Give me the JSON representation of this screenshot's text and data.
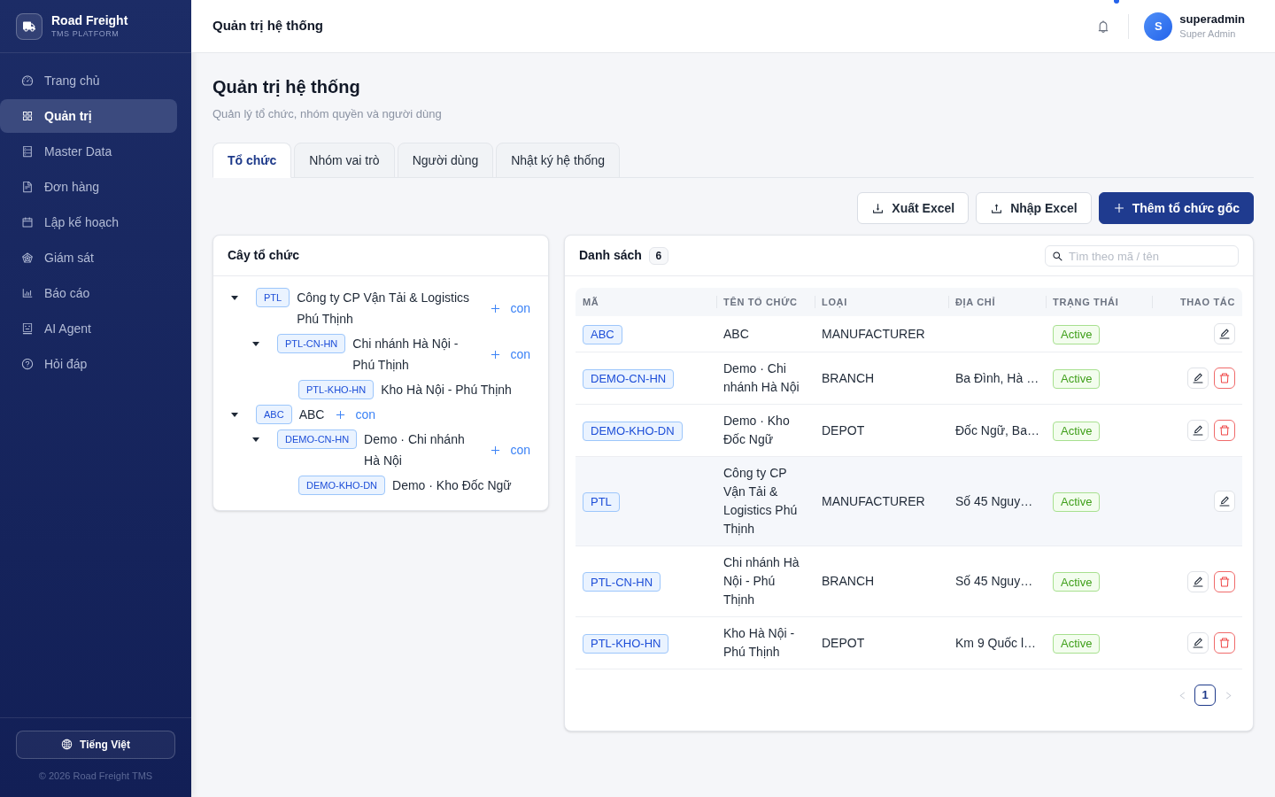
{
  "sidebar": {
    "brand": {
      "name": "Road Freight",
      "tagline": "TMS PLATFORM"
    },
    "items": [
      {
        "label": "Trang chủ",
        "selected": false
      },
      {
        "label": "Quản trị",
        "selected": true
      },
      {
        "label": "Master Data",
        "selected": false
      },
      {
        "label": "Đơn hàng",
        "selected": false
      },
      {
        "label": "Lập kế hoạch",
        "selected": false
      },
      {
        "label": "Giám sát",
        "selected": false
      },
      {
        "label": "Báo cáo",
        "selected": false
      },
      {
        "label": "AI Agent",
        "selected": false
      },
      {
        "label": "Hỏi đáp",
        "selected": false
      }
    ],
    "language_button": "Tiếng Việt",
    "footer": "© 2026 Road Freight TMS"
  },
  "header": {
    "title": "Quản trị hệ thống",
    "has_notification": true,
    "user": {
      "initial": "S",
      "name": "superadmin",
      "role": "Super Admin"
    }
  },
  "page": {
    "title": "Quản trị hệ thống",
    "subtitle": "Quản lý tổ chức, nhóm quyền và người dùng"
  },
  "tabs": [
    {
      "label": "Tổ chức",
      "selected": true
    },
    {
      "label": "Nhóm vai trò",
      "selected": false
    },
    {
      "label": "Người dùng",
      "selected": false
    },
    {
      "label": "Nhật ký hệ thống",
      "selected": false
    }
  ],
  "actions": [
    {
      "label": "Xuất Excel",
      "kind": "export"
    },
    {
      "label": "Nhập Excel",
      "kind": "import"
    },
    {
      "label": "Thêm tổ chức gốc",
      "kind": "primary"
    }
  ],
  "tree_panel": {
    "title": "Cây tổ chức",
    "nodes": [
      {
        "code": "PTL",
        "name": "Công ty CP Vận Tải & Logistics Phú Thịnh",
        "expanded": true,
        "add_label": "con",
        "children": [
          {
            "code": "PTL-CN-HN",
            "name": "Chi nhánh Hà Nội - Phú Thịnh",
            "expanded": true,
            "add_label": "con",
            "children": [
              {
                "code": "PTL-KHO-HN",
                "name": "Kho Hà Nội - Phú Thịnh"
              }
            ]
          }
        ]
      },
      {
        "code": "ABC",
        "name": "ABC",
        "expanded": true,
        "add_label": "con",
        "children": [
          {
            "code": "DEMO-CN-HN",
            "name": "Demo · Chi nhánh Hà Nội",
            "expanded": true,
            "add_label": "con",
            "children": [
              {
                "code": "DEMO-KHO-DN",
                "name": "Demo · Kho Đốc Ngữ"
              }
            ]
          }
        ]
      }
    ]
  },
  "list_panel": {
    "title": "Danh sách",
    "count": "6",
    "search": {
      "placeholder": "Tìm theo mã / tên"
    },
    "table": {
      "columns": [
        "MÃ",
        "TÊN TỔ CHỨC",
        "LOẠI",
        "ĐỊA CHỈ",
        "TRẠNG THÁI",
        "THAO TÁC"
      ],
      "rows": [
        {
          "code": "ABC",
          "name": "ABC",
          "type": "MANUFACTURER",
          "status": "Active",
          "hovered": false,
          "can_delete": false
        },
        {
          "code": "DEMO-CN-HN",
          "name": "Demo · Chi nhánh Hà Nội",
          "type": "BRANCH",
          "address": "Ba Đình, Hà …",
          "status": "Active",
          "hovered": false,
          "can_delete": true
        },
        {
          "code": "DEMO-KHO-DN",
          "name": "Demo · Kho Đốc Ngữ",
          "type": "DEPOT",
          "address": "Đốc Ngữ, Ba…",
          "status": "Active",
          "hovered": false,
          "can_delete": true
        },
        {
          "code": "PTL",
          "name": "Công ty CP Vận Tải & Logistics Phú Thịnh",
          "type": "MANUFACTURER",
          "address": "Số 45 Nguy…",
          "status": "Active",
          "hovered": true,
          "can_delete": false
        },
        {
          "code": "PTL-CN-HN",
          "name": "Chi nhánh Hà Nội - Phú Thịnh",
          "type": "BRANCH",
          "address": "Số 45 Nguy…",
          "status": "Active",
          "hovered": false,
          "can_delete": true
        },
        {
          "code": "PTL-KHO-HN",
          "name": "Kho Hà Nội - Phú Thịnh",
          "type": "DEPOT",
          "address": "Km 9 Quốc l…",
          "status": "Active",
          "hovered": false,
          "can_delete": true
        }
      ]
    },
    "pagination": {
      "prev_disabled": true,
      "next_disabled": true,
      "pages": [
        {
          "label": "1",
          "selected": true
        }
      ]
    }
  }
}
